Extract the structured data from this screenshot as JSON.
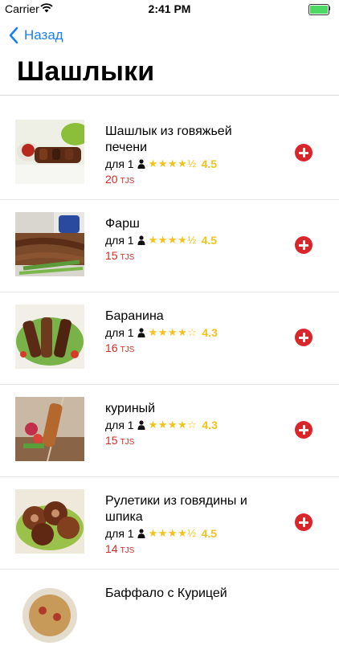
{
  "status": {
    "carrier": "Carrier",
    "time": "2:41 PM"
  },
  "nav": {
    "back_label": "Назад"
  },
  "page": {
    "title": "Шашлыки"
  },
  "accent_color": "#1a7ff5",
  "price_color": "#d42b26",
  "star_color": "#f4c21a",
  "items": [
    {
      "name": "Шашлык из говяжьей печени",
      "portion": "для 1",
      "stars": "★★★★½",
      "rating": "4.5",
      "price": "20",
      "currency": "TJS"
    },
    {
      "name": "Фарш",
      "portion": "для 1",
      "stars": "★★★★½",
      "rating": "4.5",
      "price": "15",
      "currency": "TJS"
    },
    {
      "name": "Баранина",
      "portion": "для 1",
      "stars": "★★★★☆",
      "rating": "4.3",
      "price": "16",
      "currency": "TJS"
    },
    {
      "name": "куриный",
      "portion": "для 1",
      "stars": "★★★★☆",
      "rating": "4.3",
      "price": "15",
      "currency": "TJS"
    },
    {
      "name": "Рулетики из говядины и шпика",
      "portion": "для 1",
      "stars": "★★★★½",
      "rating": "4.5",
      "price": "14",
      "currency": "TJS"
    },
    {
      "name": "Баффало с Курицей",
      "portion": "",
      "stars": "",
      "rating": "",
      "price": "",
      "currency": ""
    }
  ]
}
